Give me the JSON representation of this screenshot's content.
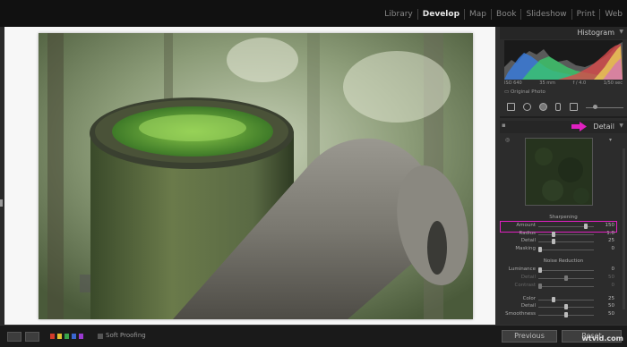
{
  "modules": [
    "Library",
    "Develop",
    "Map",
    "Book",
    "Slideshow",
    "Print",
    "Web"
  ],
  "active_module": "Develop",
  "panel": {
    "histogram_title": "Histogram",
    "histogram_info": [
      "ISO 640",
      "35 mm",
      "f / 4.0",
      "1/50 sec"
    ],
    "original_photo": "Original Photo",
    "detail_title": "Detail",
    "sharpening": {
      "title": "Sharpening",
      "rows": [
        {
          "label": "Amount",
          "value": "150",
          "pos": 0.88
        },
        {
          "label": "Radius",
          "value": "1.0",
          "pos": 0.25
        },
        {
          "label": "Detail",
          "value": "25",
          "pos": 0.25
        },
        {
          "label": "Masking",
          "value": "0",
          "pos": 0.0
        }
      ]
    },
    "noise": {
      "title": "Noise Reduction",
      "rows": [
        {
          "label": "Luminance",
          "value": "0",
          "pos": 0.0,
          "dim": false
        },
        {
          "label": "Detail",
          "value": "50",
          "pos": 0.5,
          "dim": true
        },
        {
          "label": "Contrast",
          "value": "0",
          "pos": 0.0,
          "dim": true
        },
        {
          "label": "Color",
          "value": "25",
          "pos": 0.25,
          "dim": false
        },
        {
          "label": "Detail",
          "value": "50",
          "pos": 0.5,
          "dim": false
        },
        {
          "label": "Smoothness",
          "value": "50",
          "pos": 0.5,
          "dim": false
        }
      ]
    }
  },
  "bottom": {
    "soft_proofing": "Soft Proofing",
    "previous": "Previous",
    "reset": "Reset",
    "swatches": [
      "#d23a2a",
      "#e0c030",
      "#3aa64a",
      "#3a66d0",
      "#9a3ad0"
    ]
  },
  "colors": {
    "highlight": "#e020c0",
    "arrow": "#e020c0"
  },
  "watermark": "wtvid.com"
}
